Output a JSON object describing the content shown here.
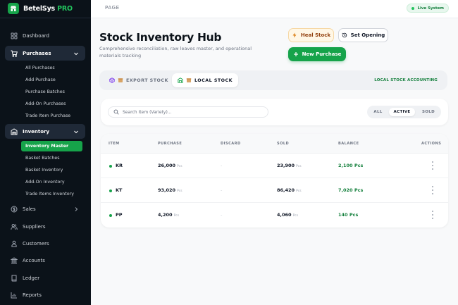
{
  "brand": {
    "name": "BetelSys",
    "suffix": "PRO"
  },
  "nav": {
    "dashboard": "Dashboard",
    "purchases": "Purchases",
    "purchases_sub": [
      "All Purchases",
      "Add Purchase",
      "Purchase Batches",
      "Add-On Purchases",
      "Trade Item Purchase"
    ],
    "inventory": "Inventory",
    "inventory_sub": [
      "Inventory Master",
      "Basket Batches",
      "Basket Inventory",
      "Add-On Inventory",
      "Trade Items Inventory"
    ],
    "sales": "Sales",
    "suppliers": "Suppliers",
    "customers": "Customers",
    "accounts": "Accounts",
    "ledger": "Ledger",
    "reports": "Reports"
  },
  "topbar": {
    "crumb": "PAGE",
    "status": "Live System"
  },
  "header": {
    "title": "Stock Inventory Hub",
    "subtitle": "Comprehensive reconciliation, raw leaves master, and operational materials tracking",
    "heal_label": "Heal Stock",
    "set_opening_label": "Set Opening",
    "new_purchase_label": "New Purchase"
  },
  "tabs": {
    "export": "EXPORT STOCK",
    "local": "LOCAL STOCK",
    "note": "LOCAL STOCK ACCOUNTING"
  },
  "search": {
    "placeholder": "Search Item (Variety)..."
  },
  "filters": {
    "all": "ALL",
    "active": "ACTIVE",
    "sold": "SOLD"
  },
  "table": {
    "headers": {
      "item": "ITEM",
      "purchase": "PURCHASE",
      "discard": "DISCARD",
      "sold": "SOLD",
      "balance": "BALANCE",
      "actions": "ACTIONS"
    },
    "rows": [
      {
        "item": "KR",
        "purchase": "26,000",
        "purchase_unit": "Pcs",
        "discard": "-",
        "sold": "23,900",
        "sold_unit": "Pcs",
        "balance": "2,100 Pcs"
      },
      {
        "item": "KT",
        "purchase": "93,020",
        "purchase_unit": "Pcs",
        "discard": "-",
        "sold": "86,420",
        "sold_unit": "Pcs",
        "balance": "7,020 Pcs"
      },
      {
        "item": "PP",
        "purchase": "4,200",
        "purchase_unit": "Pcs",
        "discard": "-",
        "sold": "4,060",
        "sold_unit": "Pcs",
        "balance": "140 Pcs"
      }
    ]
  },
  "colors": {
    "accent": "#16a34a",
    "sidebar": "#0b1219",
    "heal_bg": "#fff7e6"
  },
  "icons": {
    "brand": "store-icon",
    "dashboard": "grid-icon",
    "purchases": "cart-icon",
    "inventory": "warehouse-icon",
    "sales": "dollar-icon",
    "suppliers": "users-icon",
    "customers": "user-group-icon",
    "accounts": "bank-icon",
    "ledger": "book-icon",
    "reports": "chart-icon"
  }
}
